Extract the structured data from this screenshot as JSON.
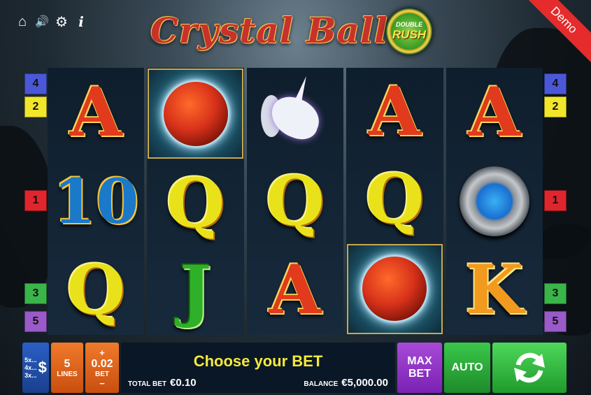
{
  "game": {
    "title": "Crystal Ball",
    "badge_line1": "DOUBLE",
    "badge_line2": "RUSH",
    "demo": "Demo"
  },
  "top_icons": [
    "home-icon",
    "sound-icon",
    "settings-icon",
    "info-icon"
  ],
  "top_icon_glyphs": [
    "⌂",
    "🔊",
    "⚙",
    "i"
  ],
  "reels": [
    [
      "A",
      "10",
      "Q"
    ],
    [
      "orb",
      "Q",
      "J"
    ],
    [
      "unicorn",
      "Q",
      "A"
    ],
    [
      "A",
      "Q",
      "orb"
    ],
    [
      "A",
      "amulet",
      "K"
    ]
  ],
  "line_markers_left": [
    "4",
    "2",
    "1",
    "3",
    "5"
  ],
  "line_markers_right": [
    "4",
    "2",
    "1",
    "3",
    "5"
  ],
  "line_colors": {
    "1": "#e0262c",
    "2": "#f2e62a",
    "3": "#39b54a",
    "4": "#4a58d8",
    "5": "#9a5ac8"
  },
  "controls": {
    "coins_labels": [
      "5x...",
      "4x...",
      "3x..."
    ],
    "coins_symbol": "$",
    "lines_value": "5",
    "lines_label": "LINES",
    "bet_plus": "+",
    "bet_value": "0.02",
    "bet_label": "BET",
    "bet_minus": "−",
    "message": "Choose your BET",
    "total_bet_label": "TOTAL BET",
    "total_bet_value": "€0.10",
    "balance_label": "BALANCE",
    "balance_value": "€5,000.00",
    "max_bet_line1": "MAX",
    "max_bet_line2": "BET",
    "auto_label": "AUTO"
  }
}
